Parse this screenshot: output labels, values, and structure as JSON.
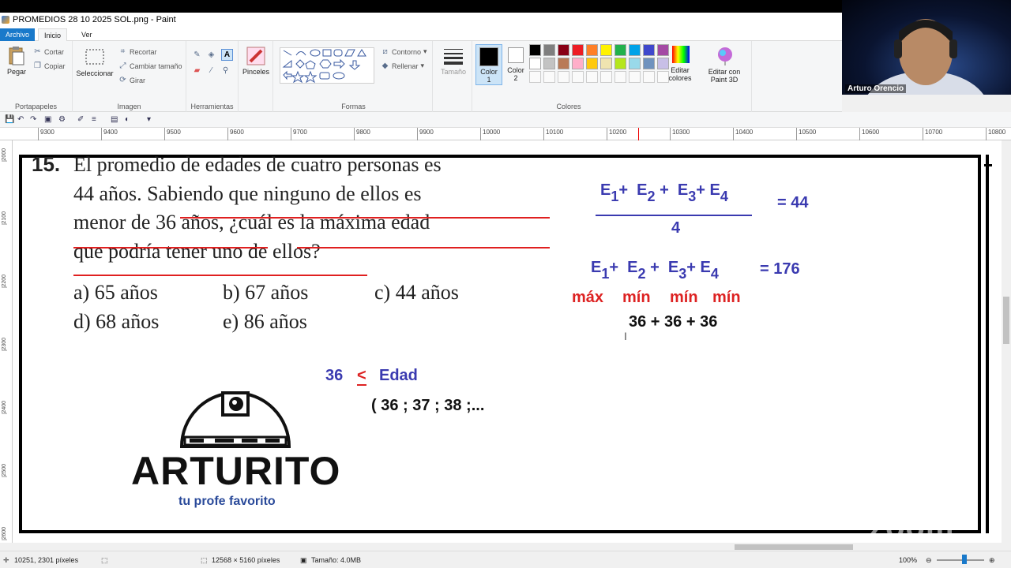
{
  "window": {
    "title": "PROMEDIOS 28 10 2025 SOL.png - Paint"
  },
  "menu": {
    "file": "Archivo",
    "home": "Inicio",
    "view": "Ver"
  },
  "ribbon": {
    "clipboard": {
      "label": "Portapapeles",
      "paste": "Pegar",
      "cut": "Cortar",
      "copy": "Copiar"
    },
    "image": {
      "label": "Imagen",
      "select": "Seleccionar",
      "crop": "Recortar",
      "resize": "Cambiar tamaño",
      "rotate": "Girar"
    },
    "tools": {
      "label": "Herramientas"
    },
    "brushes": {
      "label": "Pinceles"
    },
    "shapes": {
      "label": "Formas",
      "outline": "Contorno",
      "fill": "Rellenar"
    },
    "size": {
      "label": "Tamaño"
    },
    "colors": {
      "label": "Colores",
      "color1": "Color 1",
      "color2": "Color 2",
      "edit": "Editar colores",
      "paint3d": "Editar con Paint 3D",
      "palette": [
        "#000000",
        "#7f7f7f",
        "#880015",
        "#ed1c24",
        "#ff7f27",
        "#fff200",
        "#22b14c",
        "#00a2e8",
        "#3f48cc",
        "#a349a4",
        "#ffffff",
        "#c3c3c3",
        "#b97a57",
        "#ffaec9",
        "#ffc90e",
        "#efe4b0",
        "#b5e61d",
        "#99d9ea",
        "#7092be",
        "#c8bfe7"
      ]
    }
  },
  "ruler": {
    "ticks": [
      "9300",
      "9400",
      "9500",
      "9600",
      "9700",
      "9800",
      "9900",
      "10000",
      "10100",
      "10200",
      "10300",
      "10400",
      "10500",
      "10600",
      "10700",
      "10800"
    ],
    "vticks": [
      "2000",
      "2100",
      "2200",
      "2300",
      "2400",
      "2500",
      "2600"
    ]
  },
  "problem": {
    "number": "15.",
    "line1": "El promedio de edades de cuatro personas es",
    "line2": "44 años. Sabiendo que ninguno de ellos es",
    "line3": "menor de 36 años, ¿cuál es la máxima edad",
    "line4": "que podría tener uno de ellos?",
    "options": {
      "a": "a) 65 años",
      "b": "b) 67 años",
      "c": "c) 44 años",
      "d": "d) 68 años",
      "e": "e) 86 años"
    }
  },
  "solution": {
    "E": "E",
    "s1": "1",
    "s2": "2",
    "s3": "3",
    "s4": "4",
    "plus": "+",
    "eq44": "=  44",
    "den": "4",
    "eq176": "= 176",
    "max": "máx",
    "min": "mín",
    "sum": "36 +  36  + 36",
    "ineq_left": "36",
    "ineq_sym": "<",
    "ineq_right": "Edad",
    "seq": "( 36 ; 37 ; 38 ;..."
  },
  "logo": {
    "name": "ARTURITO",
    "tagline": "tu profe favorito"
  },
  "statusbar": {
    "cursor": "10251, 2301 píxeles",
    "dims": "12568 × 5160 píxeles",
    "size": "Tamaño: 4.0MB",
    "zoom": "100%"
  },
  "webcam": {
    "name": "Arturo Orencio"
  },
  "watermark": "zoom",
  "colors": {
    "accent": "#1979ca",
    "math_blue": "#3a3ab0",
    "math_red": "#dd2222",
    "underline_red": "#e02020"
  }
}
